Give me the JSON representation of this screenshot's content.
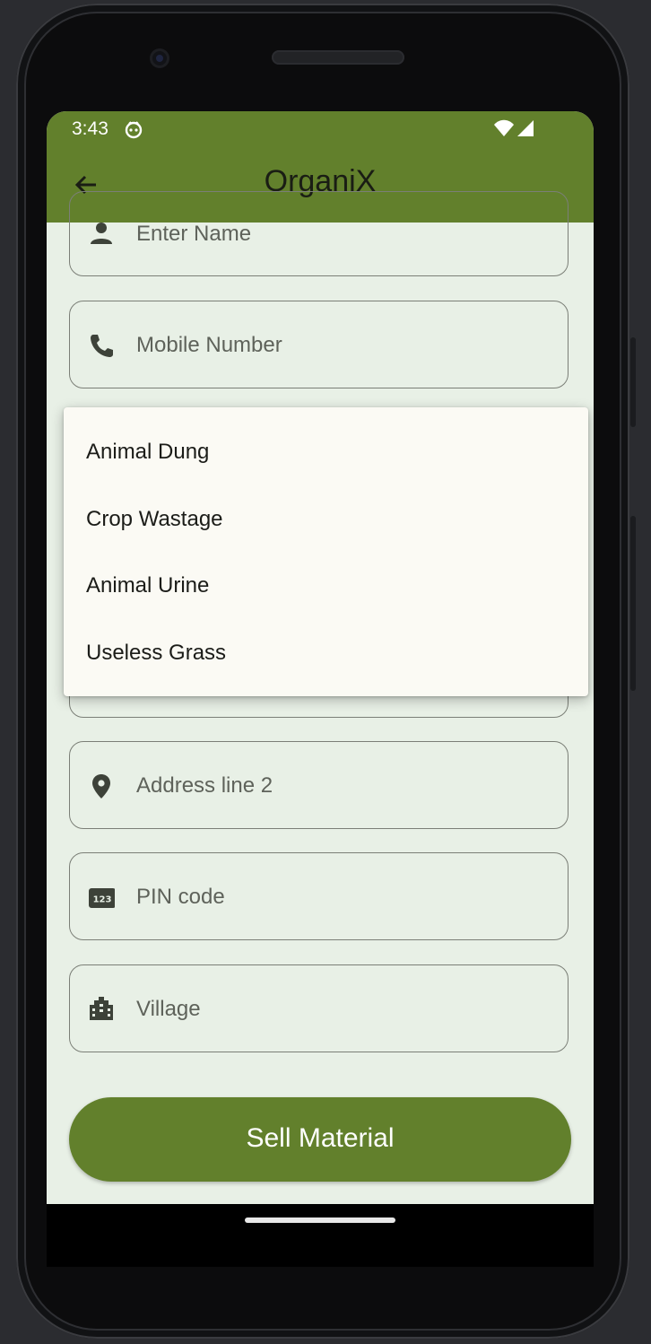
{
  "status_bar": {
    "time": "3:43",
    "icons": [
      "app-notification-icon",
      "wifi-icon",
      "signal-icon"
    ]
  },
  "app_bar": {
    "title": "OrganiX",
    "back_icon": "arrow-back-icon"
  },
  "form": {
    "name_placeholder": "Enter Name",
    "mobile_placeholder": "Mobile Number",
    "address2_placeholder": "Address line 2",
    "pin_placeholder": "PIN code",
    "village_placeholder": "Village"
  },
  "dropdown": {
    "options": [
      "Animal Dung",
      "Crop Wastage",
      "Animal Urine",
      "Useless Grass"
    ]
  },
  "actions": {
    "sell_label": "Sell Material"
  },
  "colors": {
    "primary": "#62802c",
    "background": "#e8f0e6",
    "menu": "#fbfaf4"
  }
}
